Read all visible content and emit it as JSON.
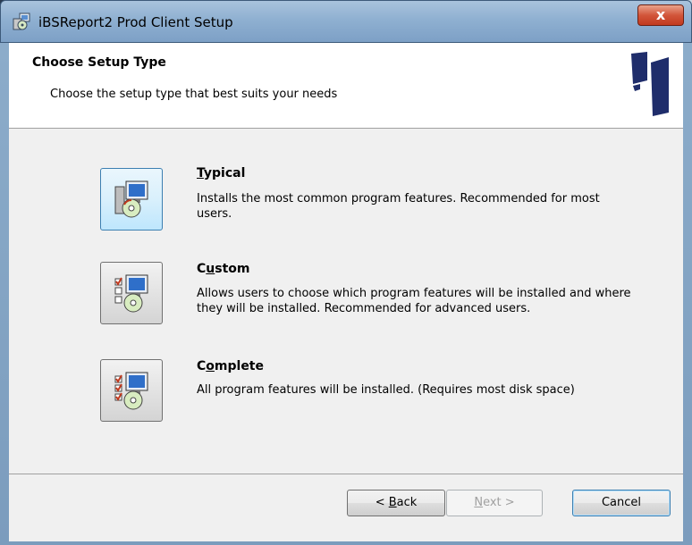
{
  "window": {
    "title": "iBSReport2 Prod Client Setup",
    "close_label": "x"
  },
  "header": {
    "title": "Choose Setup Type",
    "subtitle": "Choose the setup type that best suits your needs"
  },
  "options": [
    {
      "title_mnemonic": "T",
      "title_rest": "ypical",
      "description": "Installs the most common program features. Recommended for most users.",
      "selected": true
    },
    {
      "title_prefix": "C",
      "title_mnemonic": "u",
      "title_rest": "stom",
      "description": "Allows users to choose which program features will be installed and where they will be installed. Recommended for advanced users.",
      "selected": false
    },
    {
      "title_prefix": "C",
      "title_mnemonic": "o",
      "title_rest": "mplete",
      "description": "All program features will be installed.  (Requires most disk space)",
      "selected": false
    }
  ],
  "buttons": {
    "back_prefix": "< ",
    "back_mnemonic": "B",
    "back_rest": "ack",
    "next_mnemonic": "N",
    "next_rest": "ext >",
    "cancel": "Cancel"
  },
  "colors": {
    "accent": "#3c7fb1",
    "logo_blue": "#1f2d6b"
  }
}
